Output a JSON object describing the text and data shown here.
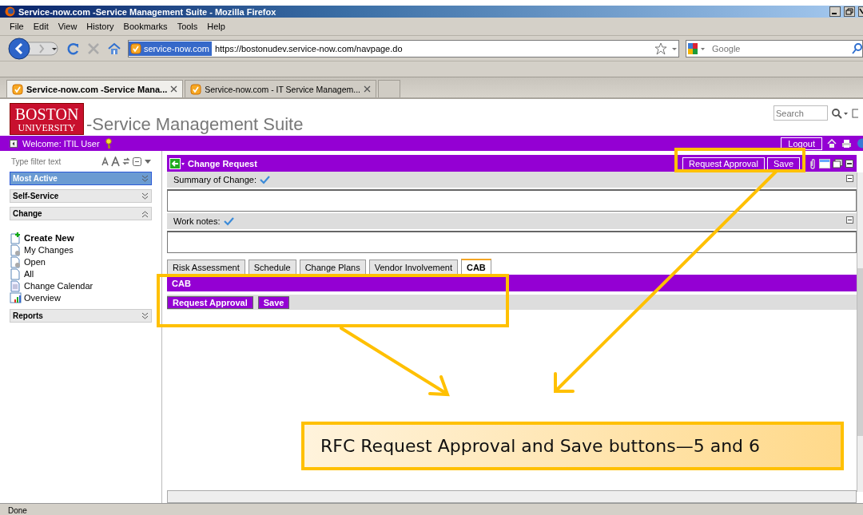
{
  "window": {
    "title": "Service-now.com -Service Management Suite - Mozilla Firefox"
  },
  "menu": [
    "File",
    "Edit",
    "View",
    "History",
    "Bookmarks",
    "Tools",
    "Help"
  ],
  "address_bar": {
    "site_badge": "service-now.com",
    "url": "https://bostonudev.service-now.com/navpage.do"
  },
  "web_search": {
    "placeholder": "Google"
  },
  "browser_tabs": [
    {
      "label": "Service-now.com -Service Mana...",
      "selected": true
    },
    {
      "label": "Service-now.com - IT Service Managem...",
      "selected": false
    }
  ],
  "header": {
    "logo": [
      "BOSTON",
      "UNIVERSITY"
    ],
    "title": "-Service Management Suite",
    "search": {
      "placeholder": "Search"
    }
  },
  "welcome_bar": {
    "text": "Welcome: ITIL User",
    "logout": "Logout"
  },
  "sidebar": {
    "filter": {
      "placeholder": "Type filter text"
    },
    "sections": [
      {
        "label": "Most Active",
        "selected": true,
        "expanded": false
      },
      {
        "label": "Self-Service",
        "selected": false,
        "expanded": false
      },
      {
        "label": "Change",
        "selected": false,
        "expanded": true,
        "items": [
          {
            "label": "Create New",
            "kind": "create"
          },
          {
            "label": "My Changes",
            "kind": "query"
          },
          {
            "label": "Open",
            "kind": "query"
          },
          {
            "label": "All",
            "kind": "list"
          },
          {
            "label": "Change Calendar",
            "kind": "calendar"
          },
          {
            "label": "Overview",
            "kind": "chart"
          }
        ]
      },
      {
        "label": "Reports",
        "selected": false,
        "expanded": false
      }
    ]
  },
  "form": {
    "title": "Change Request",
    "header_buttons": [
      "Request Approval",
      "Save"
    ],
    "fields": [
      {
        "label": "Summary of Change:"
      },
      {
        "label": "Work notes:"
      }
    ],
    "tabs": [
      {
        "label": "Risk Assessment",
        "selected": false
      },
      {
        "label": "Schedule",
        "selected": false
      },
      {
        "label": "Change Plans",
        "selected": false
      },
      {
        "label": "Vendor Involvement",
        "selected": false
      },
      {
        "label": "CAB",
        "selected": true
      }
    ],
    "section": {
      "title": "CAB",
      "buttons": [
        "Request Approval",
        "Save"
      ]
    }
  },
  "status_bar": {
    "text": "Done"
  },
  "annotation": {
    "callout": "RFC Request Approval and Save buttons—5 and 6"
  }
}
